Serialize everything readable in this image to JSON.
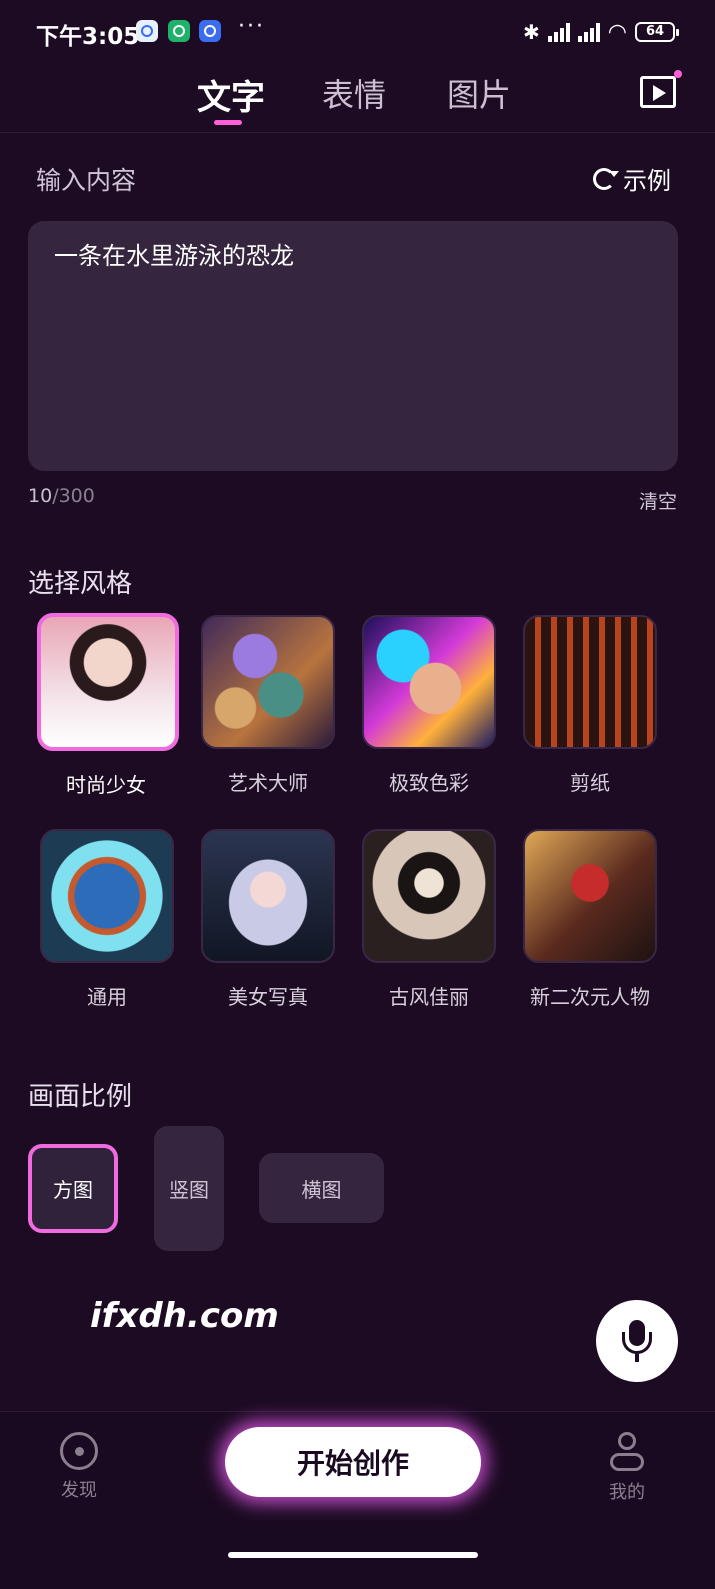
{
  "status_bar": {
    "time": "下午3:05",
    "more": "···",
    "battery": "64"
  },
  "tabs": [
    {
      "label": "文字",
      "active": true
    },
    {
      "label": "表情",
      "active": false
    },
    {
      "label": "图片",
      "active": false
    }
  ],
  "input": {
    "label": "输入内容",
    "example_label": "示例",
    "text": "一条在水里游泳的恐龙",
    "count_current": "10",
    "count_max": "/300",
    "clear_label": "清空"
  },
  "styles": {
    "title": "选择风格",
    "items": [
      {
        "label": "时尚少女",
        "selected": true
      },
      {
        "label": "艺术大师",
        "selected": false
      },
      {
        "label": "极致色彩",
        "selected": false
      },
      {
        "label": "剪纸",
        "selected": false
      },
      {
        "label": "通用",
        "selected": false
      },
      {
        "label": "美女写真",
        "selected": false
      },
      {
        "label": "古风佳丽",
        "selected": false
      },
      {
        "label": "新二次元人物",
        "selected": false
      }
    ]
  },
  "ratio": {
    "title": "画面比例",
    "options": [
      {
        "label": "方图",
        "selected": true
      },
      {
        "label": "竖图",
        "selected": false
      },
      {
        "label": "横图",
        "selected": false
      }
    ]
  },
  "watermark": "ifxdh.com",
  "bottom_nav": {
    "discover": "发现",
    "create": "开始创作",
    "mine": "我的"
  },
  "colors": {
    "accent": "#f06be0",
    "background": "#1c0b23",
    "card": "#35253f"
  }
}
